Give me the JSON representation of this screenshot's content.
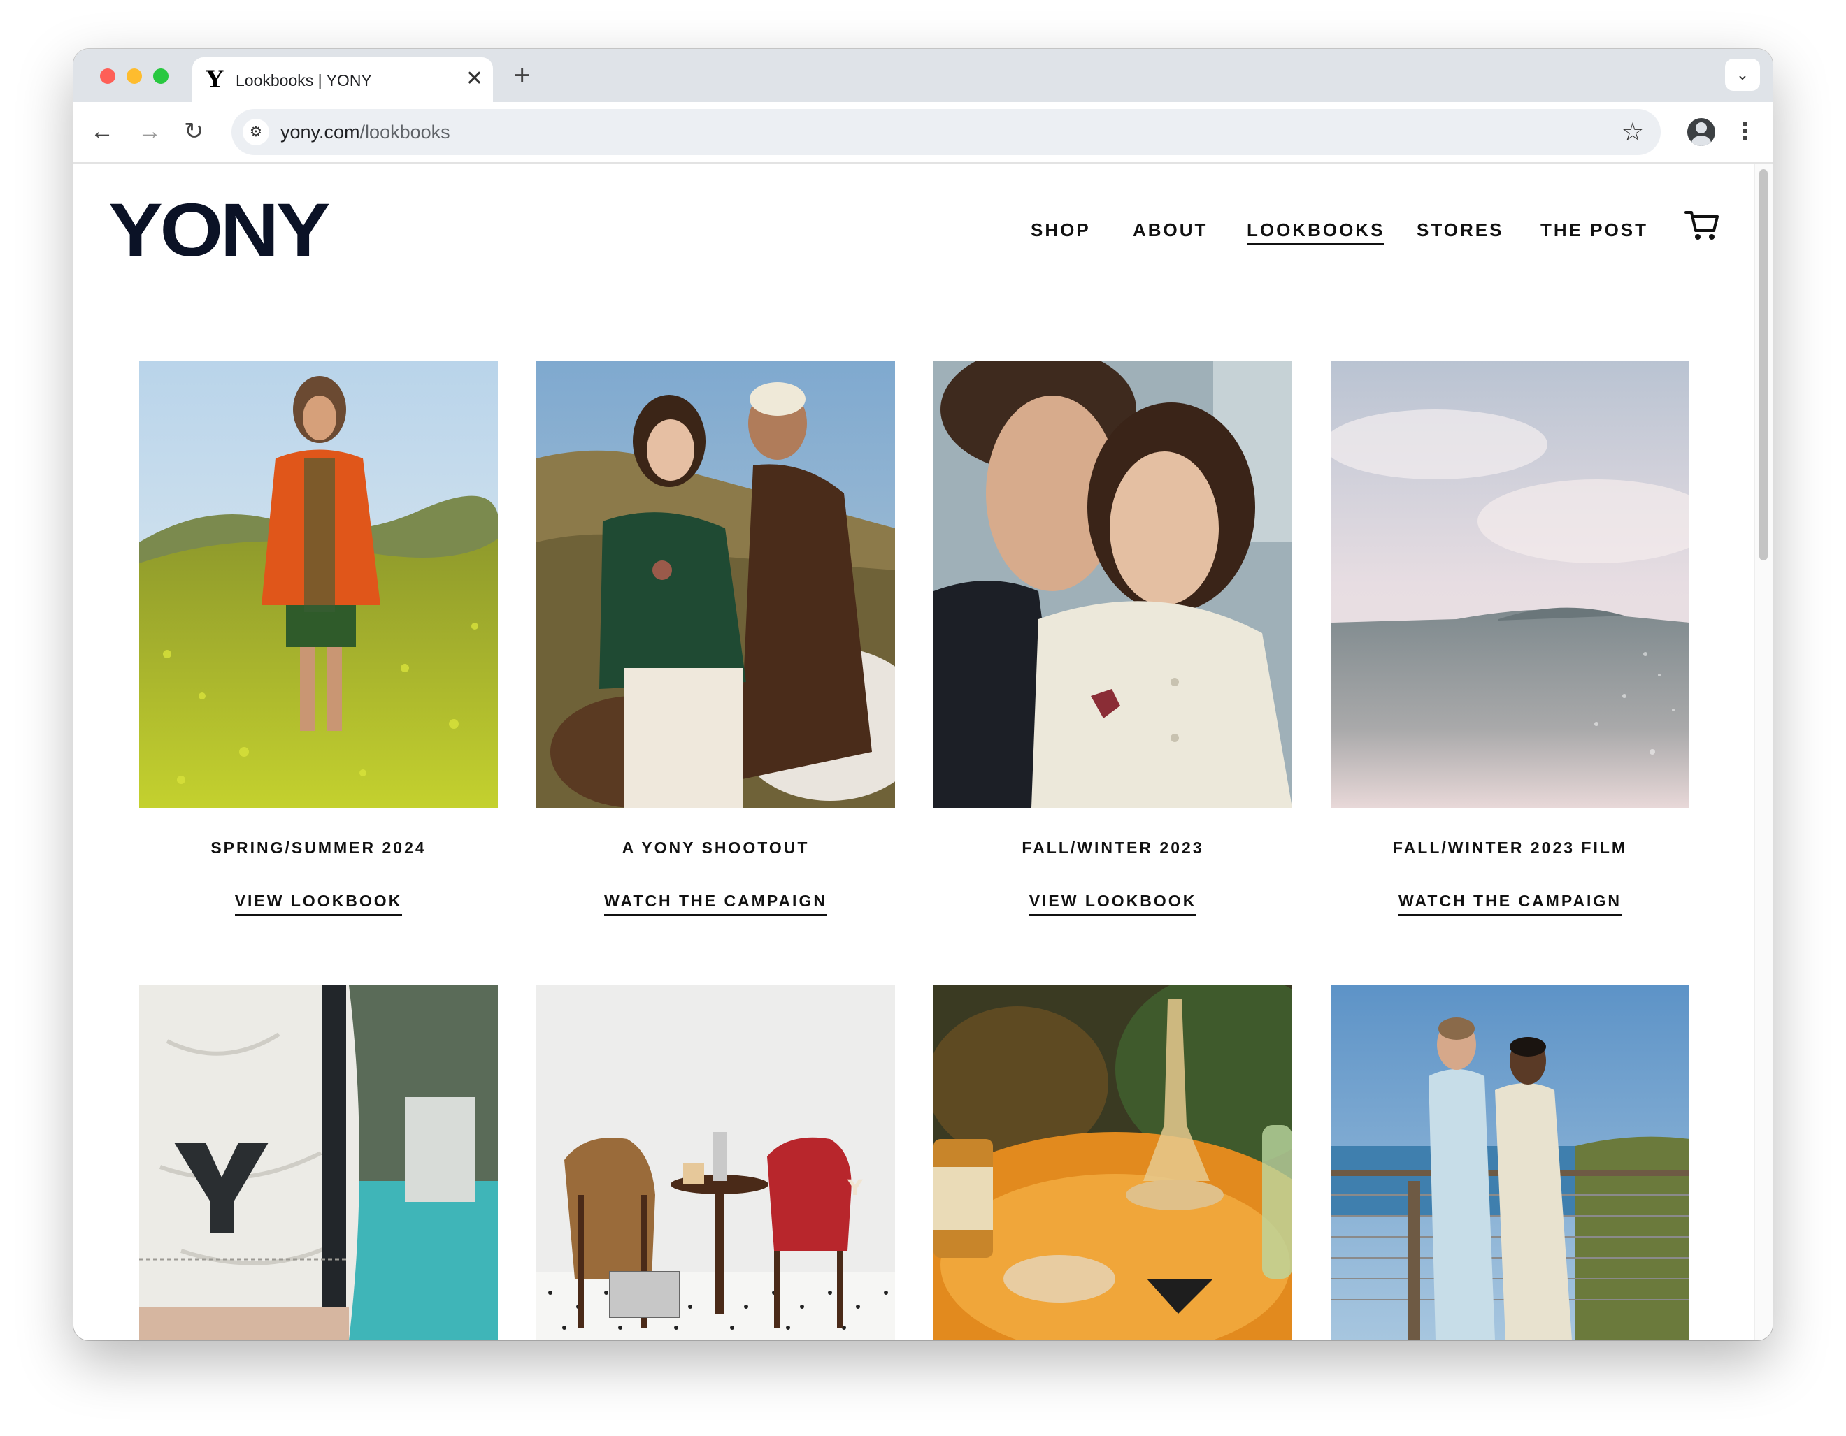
{
  "browser": {
    "tab_title": "Lookbooks | YONY",
    "tab_favicon": "Y",
    "url_host": "yony.com",
    "url_path": "/lookbooks",
    "icons": {
      "back": "arrow-left-icon",
      "forward": "arrow-right-icon",
      "reload": "reload-icon",
      "site_settings": "tune-icon",
      "bookmark": "star-icon",
      "profile": "profile-icon",
      "menu": "kebab-icon",
      "tab_close": "close-icon",
      "new_tab": "plus-icon",
      "tab_search": "chevron-down-icon"
    }
  },
  "site": {
    "logo": "YONY",
    "nav": [
      {
        "label": "SHOP"
      },
      {
        "label": "ABOUT"
      },
      {
        "label": "LOOKBOOKS",
        "active": true
      },
      {
        "label": "STORES"
      },
      {
        "label": "THE POST"
      }
    ],
    "cart_icon": "cart-icon",
    "brand_color": "#0b1226"
  },
  "lookbooks": [
    {
      "title": "SPRING/SUMMER 2024",
      "link": "VIEW LOOKBOOK",
      "image": "man-orange-jacket-flower-field"
    },
    {
      "title": "A YONY SHOOTOUT",
      "link": "WATCH THE CAMPAIGN",
      "image": "couple-on-horse-hillside"
    },
    {
      "title": "FALL/WINTER 2023",
      "link": "VIEW LOOKBOOK",
      "image": "couple-closeup-portrait"
    },
    {
      "title": "FALL/WINTER 2023 FILM",
      "link": "WATCH THE CAMPAIGN",
      "image": "pastel-ocean-sky"
    },
    {
      "title": "",
      "link": "",
      "image": "y-logo-shorts-pool"
    },
    {
      "title": "",
      "link": "",
      "image": "chairs-jackets-table"
    },
    {
      "title": "",
      "link": "",
      "image": "crystal-lamp-tabletop"
    },
    {
      "title": "",
      "link": "",
      "image": "two-men-suits-deck"
    }
  ]
}
